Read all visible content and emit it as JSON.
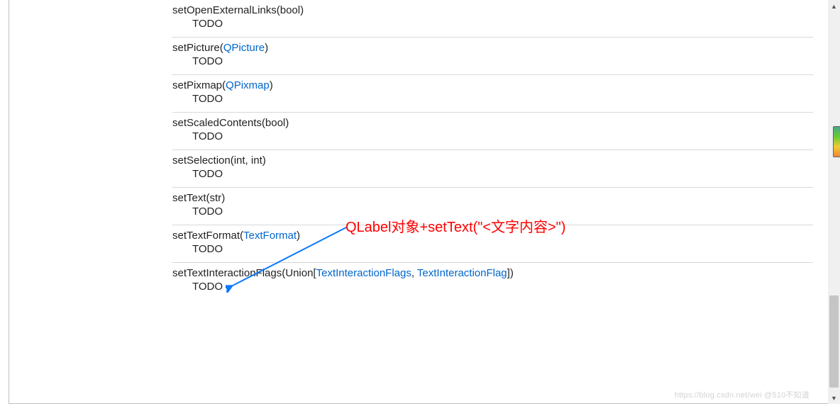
{
  "annotation": "QLabel对象+setText(\"<文字内容>\")",
  "todo_label": "TODO",
  "watermark": "https://blog.csdn.net/wei @510不知道",
  "entries": [
    {
      "prefix": "setOpenExternalLinks(",
      "args": [
        {
          "text": "bool",
          "link": false
        }
      ],
      "suffix": ")"
    },
    {
      "prefix": "setPicture(",
      "args": [
        {
          "text": "QPicture",
          "link": true
        }
      ],
      "suffix": ")"
    },
    {
      "prefix": "setPixmap(",
      "args": [
        {
          "text": "QPixmap",
          "link": true
        }
      ],
      "suffix": ")"
    },
    {
      "prefix": "setScaledContents(",
      "args": [
        {
          "text": "bool",
          "link": false
        }
      ],
      "suffix": ")"
    },
    {
      "prefix": "setSelection(",
      "args": [
        {
          "text": "int, int",
          "link": false
        }
      ],
      "suffix": ")"
    },
    {
      "prefix": "setText(",
      "args": [
        {
          "text": "str",
          "link": false
        }
      ],
      "suffix": ")"
    },
    {
      "prefix": "setTextFormat(",
      "args": [
        {
          "text": "TextFormat",
          "link": true
        }
      ],
      "suffix": ")"
    },
    {
      "prefix": "setTextInteractionFlags(Union[",
      "args": [
        {
          "text": "TextInteractionFlags",
          "link": true
        },
        {
          "text": ", ",
          "link": false
        },
        {
          "text": "TextInteractionFlag",
          "link": true
        }
      ],
      "suffix": "])"
    }
  ]
}
